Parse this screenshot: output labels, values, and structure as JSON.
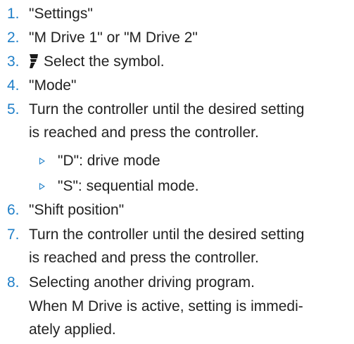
{
  "steps": [
    {
      "number": "1.",
      "lines": [
        "\"Settings\""
      ]
    },
    {
      "number": "2.",
      "lines": [
        "\"M Drive 1\" or \"M Drive 2\""
      ]
    },
    {
      "number": "3.",
      "lines": [
        "Select the symbol."
      ],
      "icon": "gear-shift-icon"
    },
    {
      "number": "4.",
      "lines": [
        "\"Mode\""
      ]
    },
    {
      "number": "5.",
      "lines": [
        "Turn the controller until the desired setting",
        "is reached and press the controller."
      ]
    },
    {
      "number": "6.",
      "lines": [
        "\"Shift position\""
      ]
    },
    {
      "number": "7.",
      "lines": [
        "Turn the controller until the desired setting",
        "is reached and press the controller."
      ]
    },
    {
      "number": "8.",
      "lines": [
        "Selecting another driving program."
      ]
    }
  ],
  "sub_items": [
    {
      "text": "\"D\": drive mode"
    },
    {
      "text": "\"S\": sequential mode."
    }
  ],
  "note_lines": [
    "When M Drive is active, setting is immedi-",
    "ately applied."
  ],
  "colors": {
    "number": "#1f7fc8",
    "text": "#222222",
    "bullet": "#1f7fc8"
  }
}
